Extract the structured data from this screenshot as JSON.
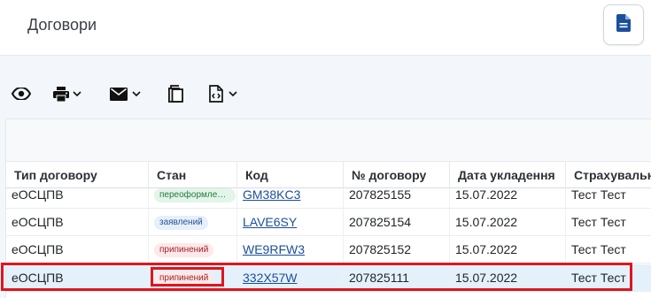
{
  "header": {
    "title": "Договори",
    "doc_button_icon": "document-icon"
  },
  "toolbar": {
    "items": [
      {
        "icon": "eye-icon",
        "dropdown": false
      },
      {
        "icon": "printer-icon",
        "dropdown": true
      },
      {
        "icon": "mail-icon",
        "dropdown": true
      },
      {
        "icon": "copy-icon",
        "dropdown": false
      },
      {
        "icon": "code-file-icon",
        "dropdown": true
      }
    ]
  },
  "table": {
    "columns": [
      "Тип договору",
      "Стан",
      "Код",
      "№ договору",
      "Дата укладення",
      "Страхувальник"
    ],
    "rows": [
      {
        "type": "еОСЦПВ",
        "status": "переоформлений",
        "status_color": "green",
        "code": "GM38KC3",
        "number": "207825155",
        "date": "15.07.2022",
        "insurer": "Тест Тест"
      },
      {
        "type": "еОСЦПВ",
        "status": "заявлений",
        "status_color": "blue",
        "code": "LAVE6SY",
        "number": "207825154",
        "date": "15.07.2022",
        "insurer": "Тест Тест"
      },
      {
        "type": "еОСЦПВ",
        "status": "припинений",
        "status_color": "red",
        "code": "WE9RFW3",
        "number": "207825152",
        "date": "15.07.2022",
        "insurer": "Тест Тест"
      },
      {
        "type": "еОСЦПВ",
        "status": "припинений",
        "status_color": "red",
        "code": "332X57W",
        "number": "207825111",
        "date": "15.07.2022",
        "insurer": "Тест Тест",
        "selected": true
      }
    ]
  },
  "colors": {
    "highlight": "#e0141e",
    "selected_row": "#e4f1fb",
    "link": "#1a4f9c",
    "primary": "#1a4f9c"
  }
}
